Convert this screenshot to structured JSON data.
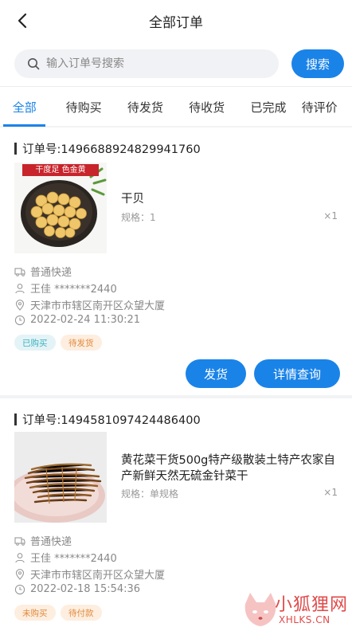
{
  "header": {
    "title": "全部订单"
  },
  "search": {
    "placeholder": "输入订单号搜索",
    "button": "搜索"
  },
  "tabs": [
    {
      "label": "全部",
      "active": true
    },
    {
      "label": "待购买",
      "active": false
    },
    {
      "label": "待发货",
      "active": false
    },
    {
      "label": "待收货",
      "active": false
    },
    {
      "label": "已完成",
      "active": false
    },
    {
      "label": "待评价",
      "active": false
    }
  ],
  "orders": [
    {
      "order_no": "订单号:1496688924829941760",
      "product_image_banner": "干度足 色金黄",
      "product_name": "干贝",
      "spec": "规格：1",
      "qty": "×1",
      "delivery": "普通快递",
      "recipient": "王佳 *******2440",
      "address": "天津市市辖区南开区众望大厦",
      "time": "2022-02-24 11:30:21",
      "badges": [
        "已购买",
        "待发货"
      ],
      "actions": [
        "发货",
        "详情查询"
      ]
    },
    {
      "order_no": "订单号:1494581097424486400",
      "product_name": "黄花菜干货500g特产级散装土特产农家自产新鲜天然无硫金针菜干",
      "spec": "规格：单规格",
      "qty": "×1",
      "delivery": "普通快递",
      "recipient": "王佳 *******2440",
      "address": "天津市市辖区南开区众望大厦",
      "time": "2022-02-18 15:54:36",
      "badges": [
        "未购买",
        "待付款"
      ]
    }
  ],
  "watermark": {
    "title": "小狐狸网",
    "sub": "XHLKS.CN"
  },
  "colors": {
    "accent": "#1a83e8",
    "badge_blue": "#3ab0c0",
    "badge_orange": "#e08a3c",
    "watermark": "#e04a4a"
  }
}
